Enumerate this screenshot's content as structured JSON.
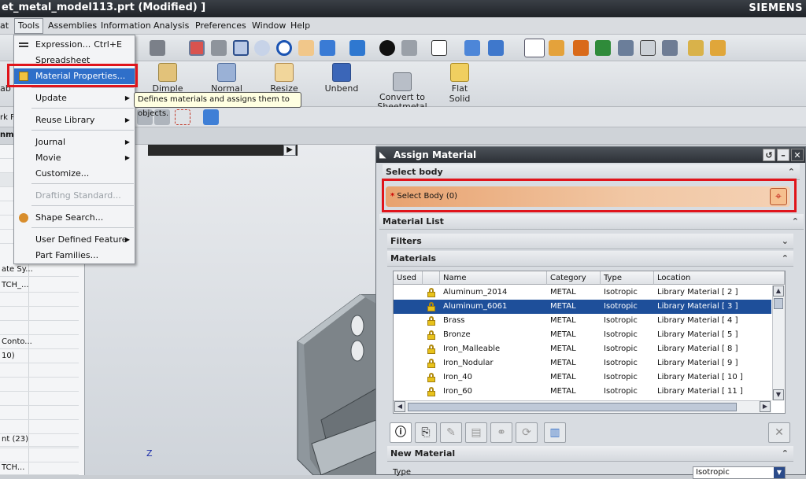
{
  "window": {
    "title": "et_metal_model113.prt (Modified) ]",
    "brand": "SIEMENS"
  },
  "menubar": {
    "items": [
      "at",
      "Tools",
      "Assemblies",
      "Information",
      "Analysis",
      "Preferences",
      "Window",
      "Help"
    ]
  },
  "toolbar_big": {
    "items": [
      "ab",
      "Dimple",
      "Normal",
      "Resize",
      "Unbend",
      "Convert to\nSheetmetal",
      "Flat Solid"
    ]
  },
  "nav_fragment": {
    "label": "rk P",
    "label2": "nm"
  },
  "left_panel": {
    "rows": [
      "",
      "",
      "",
      "",
      "",
      "",
      "",
      "ate Sy...",
      "TCH_...",
      "",
      "",
      "",
      "Conto...",
      "10)",
      "",
      "",
      "",
      "",
      "",
      "",
      "nt (23)",
      "",
      "TCH..."
    ]
  },
  "tools_menu": {
    "items": [
      {
        "label": "Expression...",
        "shortcut": "Ctrl+E"
      },
      {
        "label": "Spreadsheet"
      },
      {
        "label": "Material Properties..."
      },
      {
        "label": "Update"
      },
      {
        "label": "Reuse Library"
      },
      {
        "label": "Journal"
      },
      {
        "label": "Movie"
      },
      {
        "label": "Customize..."
      },
      {
        "label": "Drafting Standard..."
      },
      {
        "label": "Shape Search..."
      },
      {
        "label": "User Defined Feature"
      },
      {
        "label": "Part Families..."
      }
    ]
  },
  "tooltip": {
    "text": "Defines materials and assigns them to objects."
  },
  "graphics": {
    "axis_label": "Z"
  },
  "dialog": {
    "title": "Assign Material",
    "select_body_header": "Select body",
    "select_body_label": "Select Body (0)",
    "material_list_header": "Material List",
    "filters_header": "Filters",
    "materials_header": "Materials",
    "columns": [
      "Used",
      "",
      "Name",
      "Category",
      "Type",
      "Location"
    ],
    "rows": [
      {
        "name": "Aluminum_2014",
        "category": "METAL",
        "type": "Isotropic",
        "location": "Library Material [ 2 ]"
      },
      {
        "name": "Aluminum_6061",
        "category": "METAL",
        "type": "Isotropic",
        "location": "Library Material [ 3 ]"
      },
      {
        "name": "Brass",
        "category": "METAL",
        "type": "Isotropic",
        "location": "Library Material [ 4 ]"
      },
      {
        "name": "Bronze",
        "category": "METAL",
        "type": "Isotropic",
        "location": "Library Material [ 5 ]"
      },
      {
        "name": "Iron_Malleable",
        "category": "METAL",
        "type": "Isotropic",
        "location": "Library Material [ 8 ]"
      },
      {
        "name": "Iron_Nodular",
        "category": "METAL",
        "type": "Isotropic",
        "location": "Library Material [ 9 ]"
      },
      {
        "name": "Iron_40",
        "category": "METAL",
        "type": "Isotropic",
        "location": "Library Material [ 10 ]"
      },
      {
        "name": "Iron_60",
        "category": "METAL",
        "type": "Isotropic",
        "location": "Library Material [ 11 ]"
      }
    ],
    "new_material_header": "New Material",
    "type_label": "Type",
    "type_value": "Isotropic"
  },
  "colors": {
    "highlight_red": "#e0141b",
    "selection_blue": "#1e4f9a",
    "select_body_orange": "#e8a26f"
  }
}
